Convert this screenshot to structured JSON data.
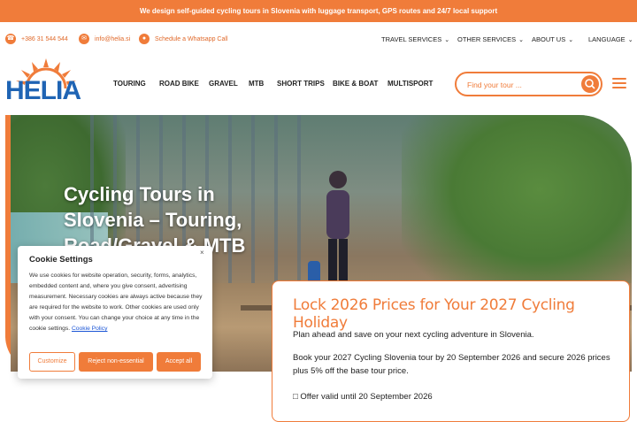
{
  "announcement": "We design self-guided cycling tours in Slovenia with luggage transport, GPS routes and 24/7 local support",
  "contacts": {
    "phone": "+386 31 544 544",
    "email": "info@helia.si",
    "whatsapp": "Schedule a Whatsapp Call"
  },
  "top_nav": [
    {
      "label": "TRAVEL SERVICES"
    },
    {
      "label": "OTHER SERVICES"
    },
    {
      "label": "ABOUT US"
    },
    {
      "label": "LANGUAGE"
    }
  ],
  "logo_text": "HELIA",
  "main_nav": [
    {
      "label": "TOURING"
    },
    {
      "label": "ROAD BIKE"
    },
    {
      "label": "GRAVEL"
    },
    {
      "label": "MTB"
    },
    {
      "label": "SHORT TRIPS"
    },
    {
      "label": "BIKE & BOAT"
    },
    {
      "label": "MULTISPORT"
    }
  ],
  "search": {
    "placeholder": "Find your tour ..."
  },
  "hero": {
    "title_lines": [
      "Cycling Tours in",
      "Slovenia – Touring,",
      "Road/Gravel & MTB"
    ]
  },
  "promo": {
    "title": "Lock 2026 Prices for Your 2027 Cycling Holiday",
    "p1": "Plan ahead and save on your next cycling adventure in Slovenia.",
    "p2": "Book your 2027 Cycling Slovenia tour by 20 September 2026 and secure 2026 prices plus 5% off the base tour price.",
    "p3": "□ Offer valid until 20 September 2026"
  },
  "cookie": {
    "title": "Cookie Settings",
    "close": "×",
    "body": "We use cookies for website operation, security, forms, analytics, embedded content and, where you give consent, advertising measurement. Necessary cookies are always active because they are required for the website to work. Other cookies are used only with your consent. You can change your choice at any time in the cookie settings.",
    "policy_link": "Cookie Policy",
    "btn_customize": "Customize",
    "btn_reject": "Reject non-essential",
    "btn_accept": "Accept all"
  },
  "colors": {
    "accent": "#f07c3a",
    "logo_blue": "#1f64b4"
  }
}
